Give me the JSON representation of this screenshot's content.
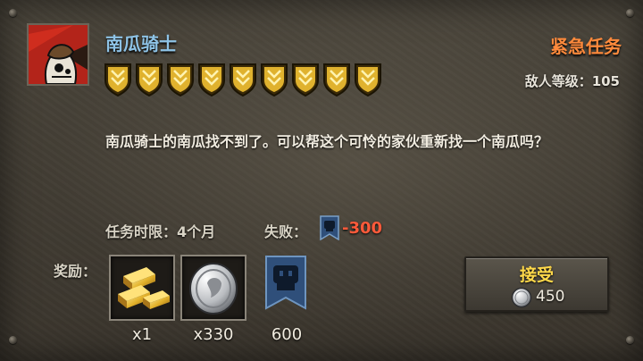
{
  "quest": {
    "title": "南瓜骑士",
    "tag": "紧急任务",
    "enemy_level_label": "敌人等级：105",
    "badge_count": 9,
    "description": "南瓜骑士的南瓜找不到了。可以帮这个可怜的家伙重新找一个南瓜吗？",
    "time_limit": "任务时限：4个月",
    "fail_label": "失败：",
    "fail_value": "-300"
  },
  "rewards": {
    "label": "奖励：",
    "items": [
      {
        "icon": "gold-bars-icon",
        "qty": "x1"
      },
      {
        "icon": "silver-coin-icon",
        "qty": "x330"
      },
      {
        "icon": "faction-banner-icon",
        "qty": "600"
      }
    ]
  },
  "accept": {
    "label": "接受",
    "cost": "450",
    "cost_icon": "silver-coin-icon"
  },
  "colors": {
    "title": "#8ec3e6",
    "urgent": "#ff8a3c",
    "fail": "#ff5a3a",
    "accept_label": "#ffd84a",
    "badge_gold": "#e0b22e",
    "banner_blue": "#2f4f7a"
  }
}
